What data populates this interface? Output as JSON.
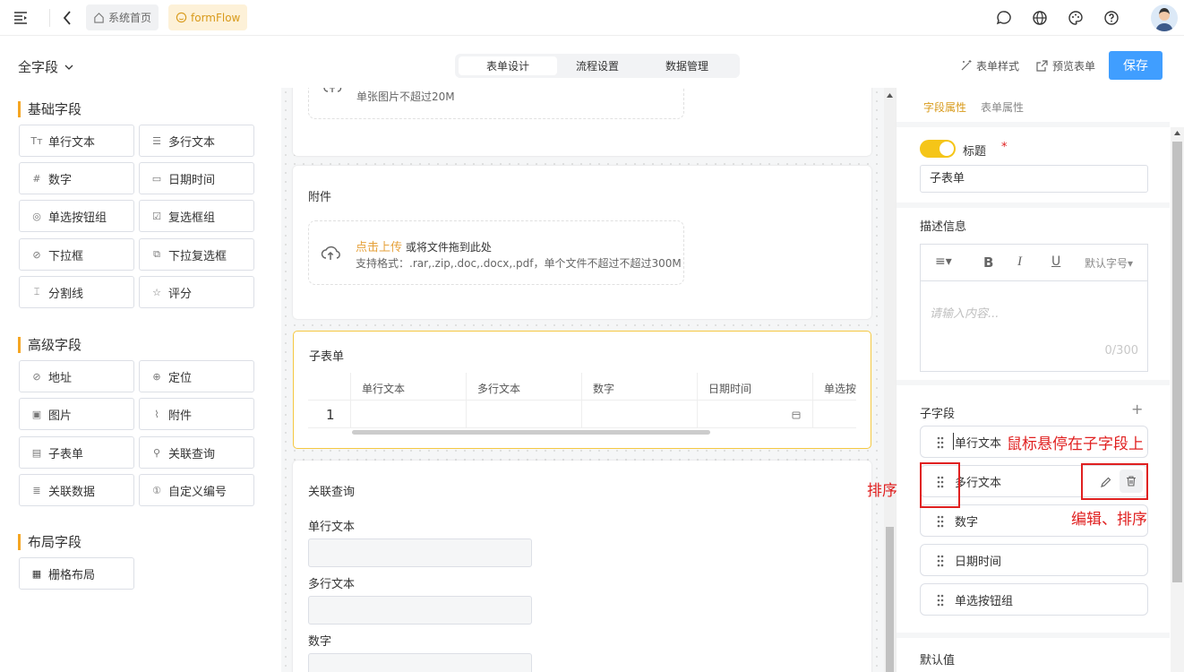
{
  "topbar": {
    "home_label": "系统首页",
    "app_label": "formFlow"
  },
  "subheader": {
    "field_filter": "全字段",
    "tabs": [
      "表单设计",
      "流程设置",
      "数据管理"
    ],
    "form_style": "表单样式",
    "preview": "预览表单",
    "save": "保存"
  },
  "left": {
    "basic_title": "基础字段",
    "basic": [
      "单行文本",
      "多行文本",
      "数字",
      "日期时间",
      "单选按钮组",
      "复选框组",
      "下拉框",
      "下拉复选框",
      "分割线",
      "评分"
    ],
    "advanced_title": "高级字段",
    "advanced": [
      "地址",
      "定位",
      "图片",
      "附件",
      "子表单",
      "关联查询",
      "关联数据",
      "自定义编号"
    ],
    "layout_title": "布局字段",
    "layout": [
      "栅格布局"
    ]
  },
  "canvas": {
    "image_hint": "单张图片不超过20M",
    "attach_title": "附件",
    "upload_link": "点击上传",
    "upload_text": "或将文件拖到此处",
    "upload_formats": "支持格式：.rar,.zip,.doc,.docx,.pdf，单个文件不超过不超过300M",
    "subform_title": "子表单",
    "subform_columns": [
      "单行文本",
      "多行文本",
      "数字",
      "日期时间",
      "单选按"
    ],
    "subform_row_no": "1",
    "lookup_title": "关联查询",
    "lookup_fields": [
      "单行文本",
      "多行文本",
      "数字"
    ]
  },
  "right": {
    "tabs": [
      "字段属性",
      "表单属性"
    ],
    "title_label": "标题",
    "required_mark": "*",
    "title_value": "子表单",
    "desc_label": "描述信息",
    "font_size": "默认字号",
    "desc_placeholder": "请输入内容...",
    "desc_count": "0/300",
    "subfields_label": "子字段",
    "add": "+",
    "subfields": [
      "单行文本",
      "多行文本",
      "数字",
      "日期时间",
      "单选按钮组"
    ],
    "default_label": "默认值"
  },
  "annotations": {
    "hover": "鼠标悬停在子字段上",
    "sort": "排序",
    "edit_sort": "编辑、排序"
  }
}
